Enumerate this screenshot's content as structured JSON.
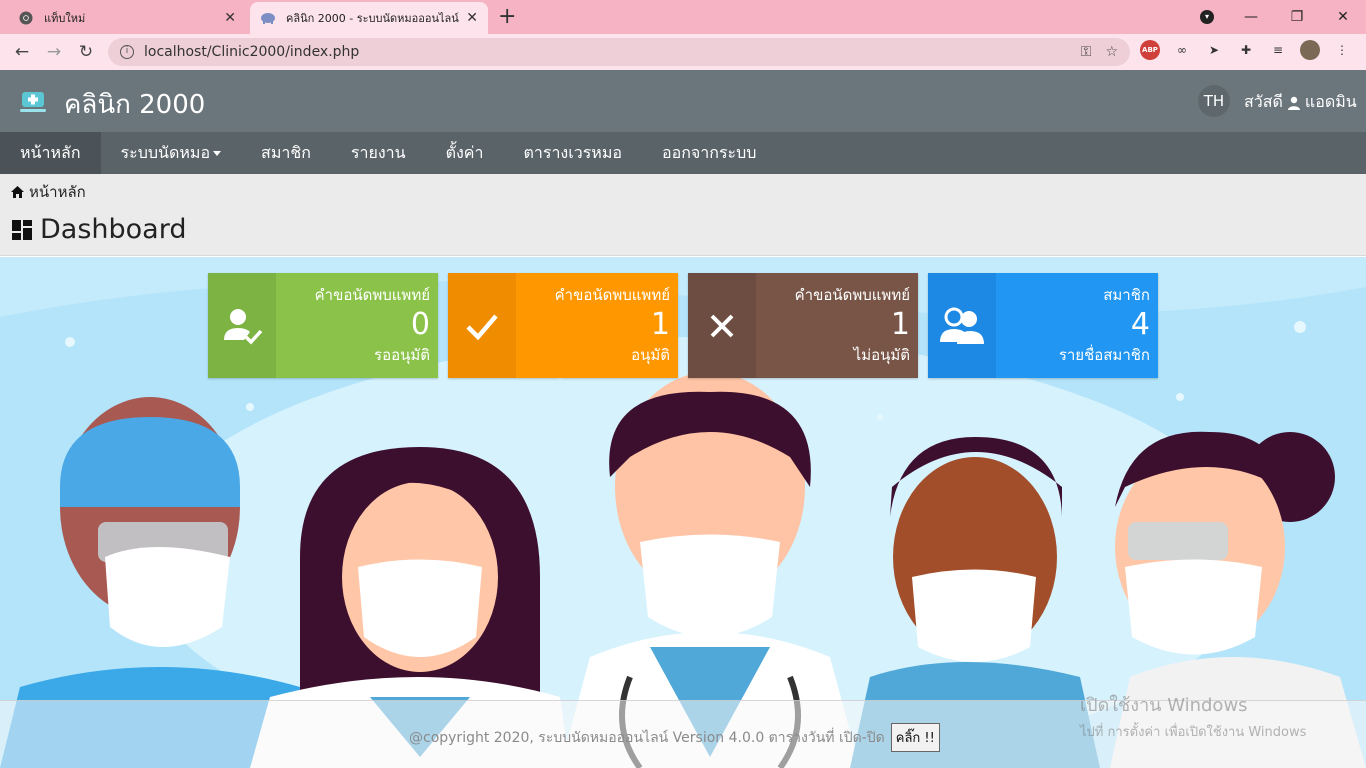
{
  "browser": {
    "tabs": [
      {
        "title": "แท็บใหม่"
      },
      {
        "title": "คลินิก 2000 - ระบบนัดหมอออนไลน์"
      }
    ],
    "url": "localhost/Clinic2000/index.php"
  },
  "header": {
    "brand": "คลินิก 2000",
    "lang": "TH",
    "greeting": "สวัสดี",
    "user": "แอดมิน"
  },
  "nav": {
    "items": [
      "หน้าหลัก",
      "ระบบนัดหมอ",
      "สมาชิก",
      "รายงาน",
      "ตั้งค่า",
      "ตารางเวรหมอ",
      "ออกจากระบบ"
    ]
  },
  "breadcrumb": "หน้าหลัก",
  "page_title": "Dashboard",
  "cards": [
    {
      "title": "คำขอนัดพบแพทย์",
      "value": "0",
      "sub": "รออนุมัติ",
      "color": "#8bc34a",
      "icon_bg": "#7cb342",
      "icon": "user-check-icon"
    },
    {
      "title": "คำขอนัดพบแพทย์",
      "value": "1",
      "sub": "อนุมัติ",
      "color": "#ff9800",
      "icon_bg": "#f08c00",
      "icon": "check-icon"
    },
    {
      "title": "คำขอนัดพบแพทย์",
      "value": "1",
      "sub": "ไม่อนุมัติ",
      "color": "#795548",
      "icon_bg": "#6d4c41",
      "icon": "x-icon"
    },
    {
      "title": "สมาชิก",
      "value": "4",
      "sub": "รายชื่อสมาชิก",
      "color": "#2196f3",
      "icon_bg": "#1e88e5",
      "icon": "users-icon"
    }
  ],
  "footer": {
    "text": "@copyright 2020, ระบบนัดหมอออนไลน์ Version 4.0.0 ตารางวันที่ เปิด-ปิด",
    "button": "คลิ๊ก !!"
  },
  "watermark": {
    "line1": "เปิดใช้งาน Windows",
    "line2": "ไปที่ การตั้งค่า เพื่อเปิดใช้งาน Windows"
  }
}
